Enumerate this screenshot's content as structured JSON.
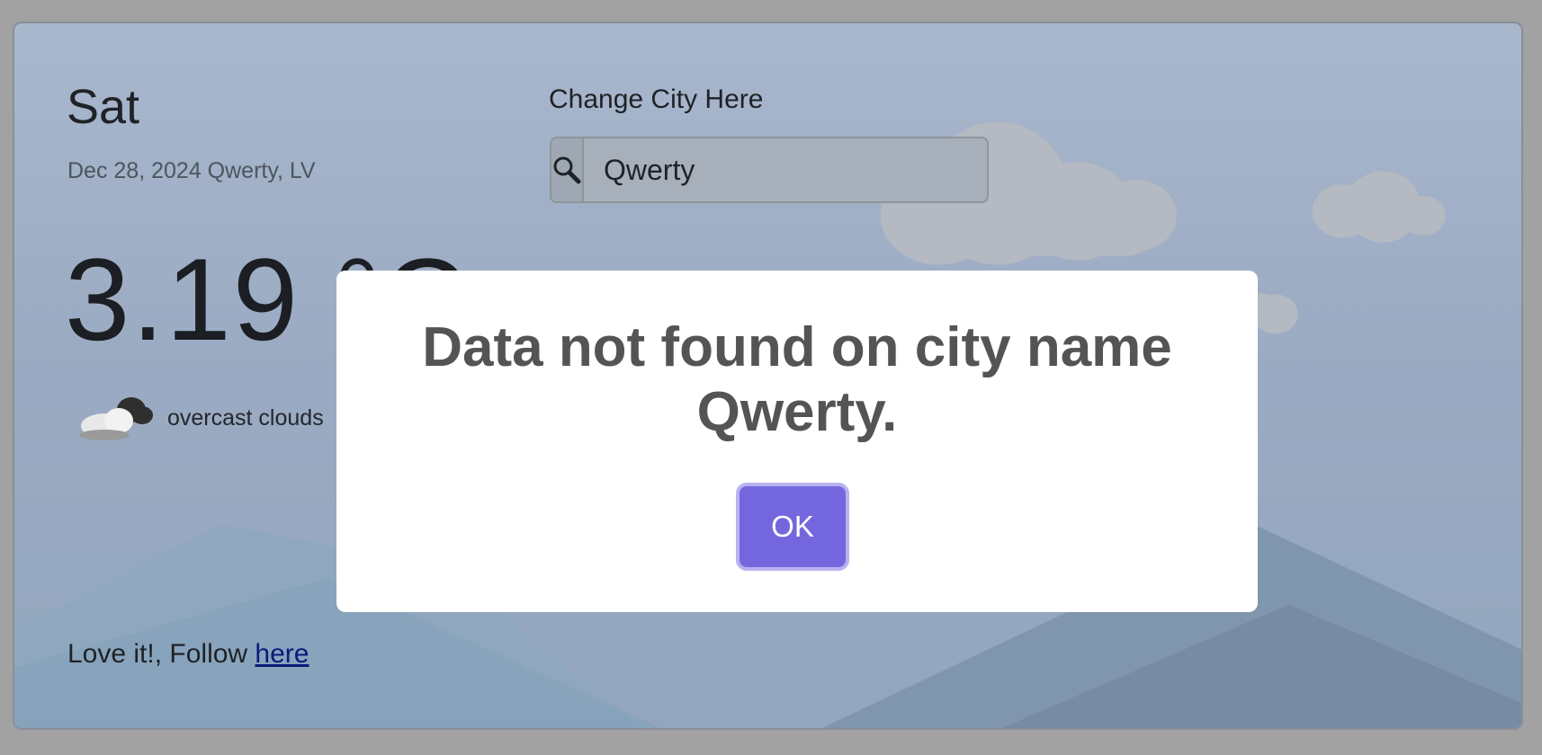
{
  "weather": {
    "day": "Sat",
    "date_location": "Dec 28, 2024 Qwerty, LV",
    "temperature": "3.19 °C",
    "description": "overcast clouds",
    "icon": "cloud-icon"
  },
  "search": {
    "label": "Change City Here",
    "value": "Qwerty",
    "icon": "search-icon"
  },
  "footer": {
    "text": "Love it!, Follow ",
    "link": "here"
  },
  "dialog": {
    "message": "Data not found on city name Qwerty.",
    "ok_label": "OK"
  },
  "colors": {
    "accent": "#7467de",
    "dialog_text": "#545454",
    "overlay_bg": "#a2a2a2"
  }
}
